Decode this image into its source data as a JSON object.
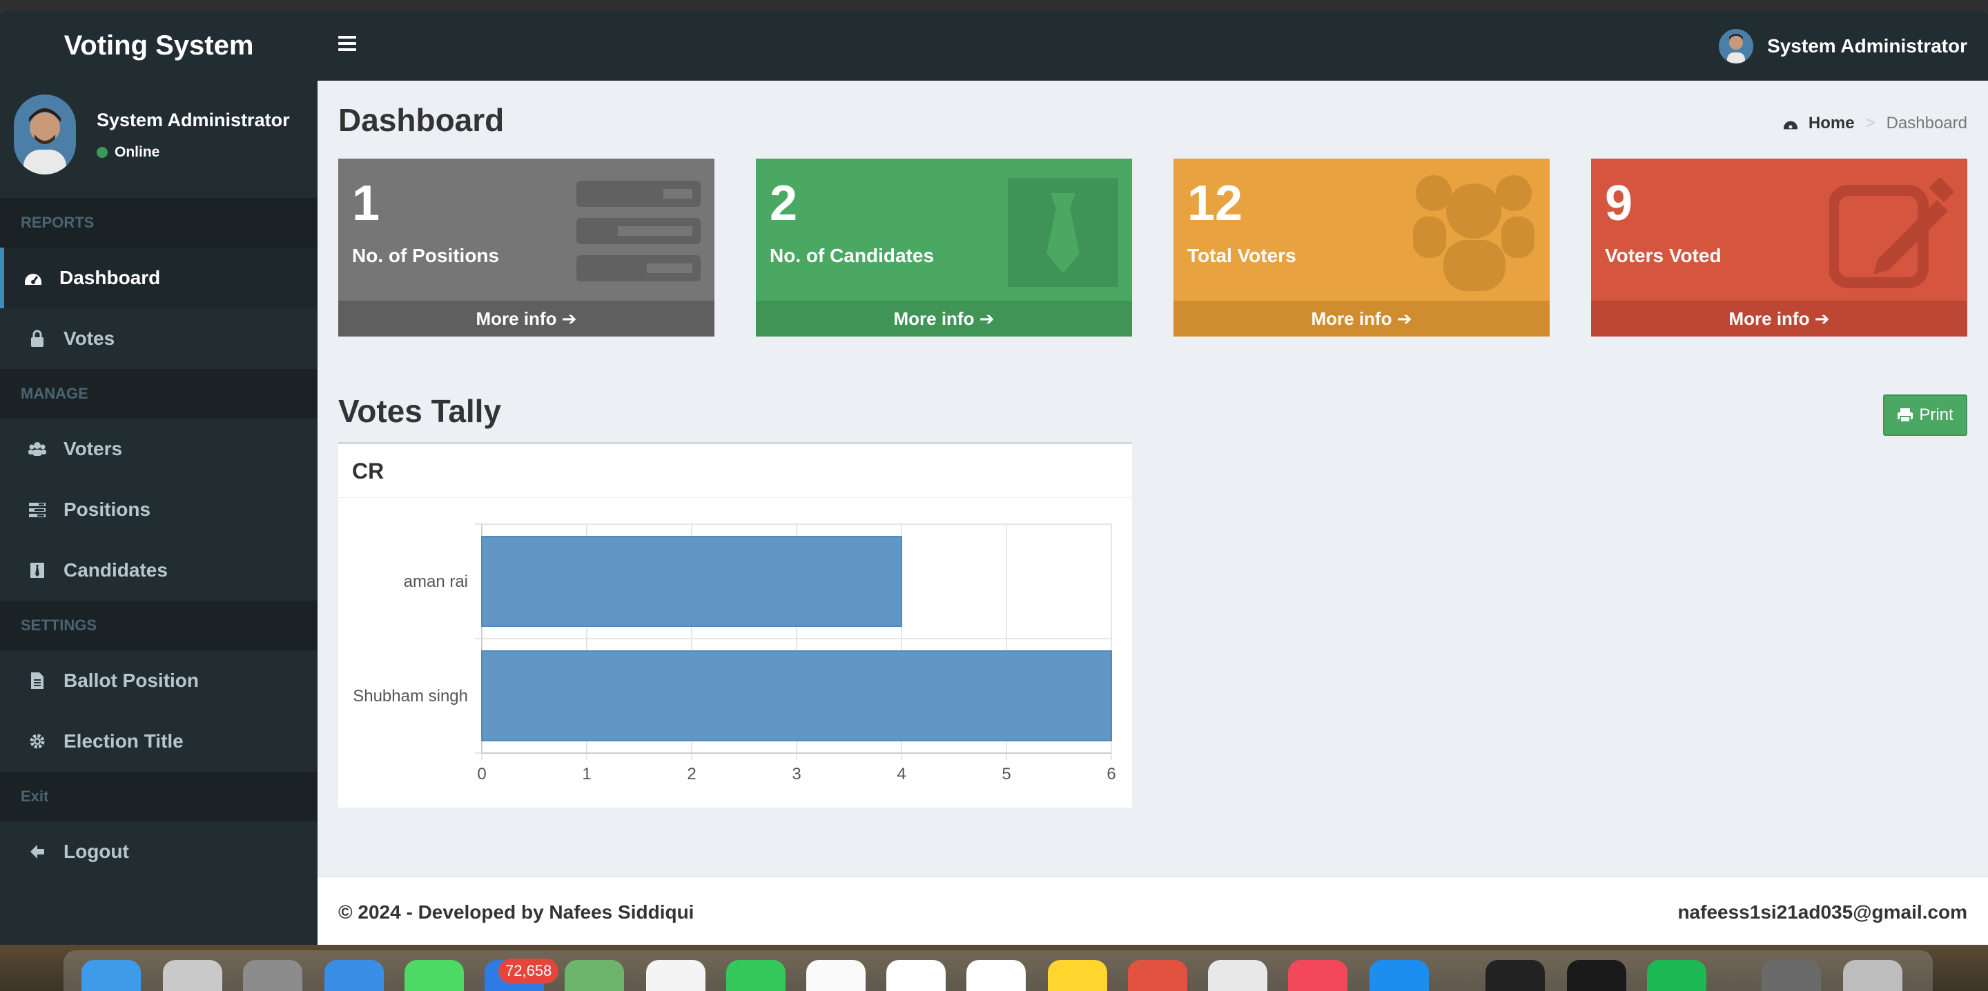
{
  "app": {
    "title": "Voting System"
  },
  "user": {
    "name": "System Administrator",
    "status": "Online"
  },
  "sidebar": {
    "sections": [
      {
        "header": "REPORTS",
        "items": [
          {
            "label": "Dashboard",
            "icon": "dashboard-icon",
            "active": true
          },
          {
            "label": "Votes",
            "icon": "lock-icon"
          }
        ]
      },
      {
        "header": "MANAGE",
        "items": [
          {
            "label": "Voters",
            "icon": "users-icon"
          },
          {
            "label": "Positions",
            "icon": "tasks-icon"
          },
          {
            "label": "Candidates",
            "icon": "black-tie-icon"
          }
        ]
      },
      {
        "header": "SETTINGS",
        "items": [
          {
            "label": "Ballot Position",
            "icon": "file-icon"
          },
          {
            "label": "Election Title",
            "icon": "cog-icon"
          }
        ]
      },
      {
        "header": "Exit",
        "items": [
          {
            "label": "Logout",
            "icon": "arrow-left-icon"
          }
        ]
      }
    ]
  },
  "page": {
    "title": "Dashboard",
    "breadcrumb": {
      "home": "Home",
      "separator": ">",
      "current": "Dashboard"
    }
  },
  "stats": [
    {
      "value": "1",
      "label": "No. of Positions",
      "more": "More info",
      "color": "#767676",
      "icon": "tasks-icon"
    },
    {
      "value": "2",
      "label": "No. of Candidates",
      "more": "More info",
      "color": "#4aa863",
      "icon": "black-tie-icon"
    },
    {
      "value": "12",
      "label": "Total Voters",
      "more": "More info",
      "color": "#e8a23f",
      "icon": "users-icon"
    },
    {
      "value": "9",
      "label": "Voters Voted",
      "more": "More info",
      "color": "#d5553f",
      "icon": "edit-icon"
    }
  ],
  "tally": {
    "title": "Votes Tally",
    "print_label": "Print"
  },
  "chart_data": {
    "type": "bar",
    "orientation": "horizontal",
    "title": "CR",
    "categories": [
      "aman rai",
      "Shubham singh"
    ],
    "values": [
      4,
      6
    ],
    "xlim": [
      0,
      6
    ],
    "xticks": [
      "0",
      "1",
      "2",
      "3",
      "4",
      "5",
      "6"
    ],
    "bar_color": "#6297c3",
    "grid": true
  },
  "footer": {
    "left": "© 2024 - Developed by Nafees Siddiqui",
    "right": "nafeess1si21ad035@gmail.com"
  },
  "dock": {
    "mail_badge": "72,658"
  }
}
